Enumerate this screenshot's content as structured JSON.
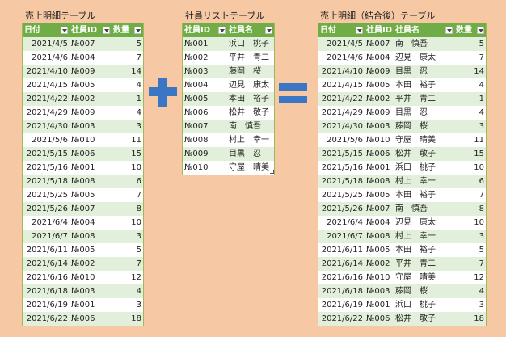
{
  "sales": {
    "title": "売上明細テーブル",
    "headers": [
      "日付",
      "社員ID",
      "数量"
    ],
    "rows": [
      [
        "2021/4/5",
        "№007",
        "5"
      ],
      [
        "2021/4/6",
        "№004",
        "7"
      ],
      [
        "2021/4/10",
        "№009",
        "14"
      ],
      [
        "2021/4/15",
        "№005",
        "4"
      ],
      [
        "2021/4/22",
        "№002",
        "1"
      ],
      [
        "2021/4/29",
        "№009",
        "4"
      ],
      [
        "2021/4/30",
        "№003",
        "3"
      ],
      [
        "2021/5/6",
        "№010",
        "11"
      ],
      [
        "2021/5/15",
        "№006",
        "15"
      ],
      [
        "2021/5/16",
        "№001",
        "10"
      ],
      [
        "2021/5/18",
        "№008",
        "6"
      ],
      [
        "2021/5/25",
        "№005",
        "7"
      ],
      [
        "2021/5/26",
        "№007",
        "8"
      ],
      [
        "2021/6/4",
        "№004",
        "10"
      ],
      [
        "2021/6/7",
        "№008",
        "3"
      ],
      [
        "2021/6/11",
        "№005",
        "5"
      ],
      [
        "2021/6/14",
        "№002",
        "7"
      ],
      [
        "2021/6/16",
        "№010",
        "12"
      ],
      [
        "2021/6/18",
        "№003",
        "4"
      ],
      [
        "2021/6/19",
        "№001",
        "3"
      ],
      [
        "2021/6/22",
        "№006",
        "18"
      ]
    ]
  },
  "employees": {
    "title": "社員リストテーブル",
    "headers": [
      "社員ID",
      "社員名"
    ],
    "rows": [
      [
        "№001",
        "浜口　桃子"
      ],
      [
        "№002",
        "平井　青二"
      ],
      [
        "№003",
        "藤岡　桜"
      ],
      [
        "№004",
        "辺見　康太"
      ],
      [
        "№005",
        "本田　裕子"
      ],
      [
        "№006",
        "松井　敬子"
      ],
      [
        "№007",
        "南　慎吾"
      ],
      [
        "№008",
        "村上　幸一"
      ],
      [
        "№009",
        "目黒　忍"
      ],
      [
        "№010",
        "守屋　晴美"
      ]
    ]
  },
  "merged": {
    "title": "売上明細（結合後）テーブル",
    "headers": [
      "日付",
      "社員ID",
      "社員名",
      "数量"
    ],
    "rows": [
      [
        "2021/4/5",
        "№007",
        "南　慎吾",
        "5"
      ],
      [
        "2021/4/6",
        "№004",
        "辺見　康太",
        "7"
      ],
      [
        "2021/4/10",
        "№009",
        "目黒　忍",
        "14"
      ],
      [
        "2021/4/15",
        "№005",
        "本田　裕子",
        "4"
      ],
      [
        "2021/4/22",
        "№002",
        "平井　青二",
        "1"
      ],
      [
        "2021/4/29",
        "№009",
        "目黒　忍",
        "4"
      ],
      [
        "2021/4/30",
        "№003",
        "藤岡　桜",
        "3"
      ],
      [
        "2021/5/6",
        "№010",
        "守屋　晴美",
        "11"
      ],
      [
        "2021/5/15",
        "№006",
        "松井　敬子",
        "15"
      ],
      [
        "2021/5/16",
        "№001",
        "浜口　桃子",
        "10"
      ],
      [
        "2021/5/18",
        "№008",
        "村上　幸一",
        "6"
      ],
      [
        "2021/5/25",
        "№005",
        "本田　裕子",
        "7"
      ],
      [
        "2021/5/26",
        "№007",
        "南　慎吾",
        "8"
      ],
      [
        "2021/6/4",
        "№004",
        "辺見　康太",
        "10"
      ],
      [
        "2021/6/7",
        "№008",
        "村上　幸一",
        "3"
      ],
      [
        "2021/6/11",
        "№005",
        "本田　裕子",
        "5"
      ],
      [
        "2021/6/14",
        "№002",
        "平井　青二",
        "7"
      ],
      [
        "2021/6/16",
        "№010",
        "守屋　晴美",
        "12"
      ],
      [
        "2021/6/18",
        "№003",
        "藤岡　桜",
        "4"
      ],
      [
        "2021/6/19",
        "№001",
        "浜口　桃子",
        "3"
      ],
      [
        "2021/6/22",
        "№006",
        "松井　敬子",
        "18"
      ]
    ]
  },
  "colors": {
    "header": "#70ad47",
    "band": "#e2efda",
    "background": "#f7c8a4",
    "operator": "#3a76c4"
  },
  "icons": {
    "plus": "plus-icon",
    "equals": "equals-icon",
    "filter": "filter-dropdown-icon"
  }
}
